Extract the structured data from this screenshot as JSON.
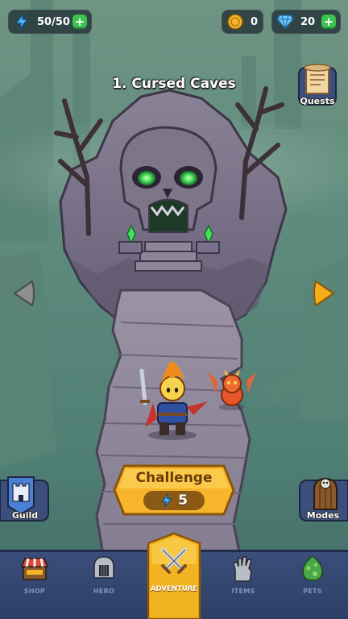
{
  "resources": {
    "energy": "50/50",
    "coins": "0",
    "gems": "20"
  },
  "level": {
    "title": "1. Cursed Caves"
  },
  "buttons": {
    "quests": "Quests",
    "guild": "Guild",
    "modes": "Modes",
    "challenge": "Challenge",
    "challenge_cost": "5"
  },
  "nav": {
    "shop": "SHOP",
    "hero": "HERO",
    "adventure": "ADVENTURE",
    "items": "ITEMS",
    "pets": "PETS",
    "active": "adventure"
  },
  "colors": {
    "plus_button": "#3cc24e",
    "challenge_button": "#f7b52c",
    "nav_background": "#33466f",
    "adventure_tab": "#f2b321",
    "eye_glow": "#44e05a"
  }
}
